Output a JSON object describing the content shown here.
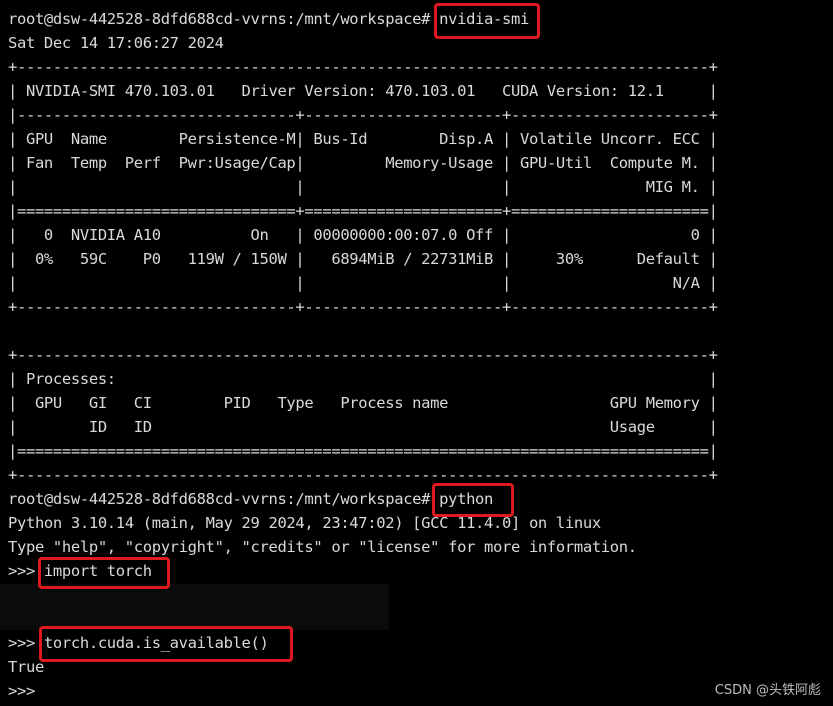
{
  "terminal": {
    "lines": [
      "root@dsw-442528-8dfd688cd-vvrns:/mnt/workspace# nvidia-smi",
      "Sat Dec 14 17:06:27 2024",
      "+-----------------------------------------------------------------------------+",
      "| NVIDIA-SMI 470.103.01   Driver Version: 470.103.01   CUDA Version: 12.1     |",
      "|-------------------------------+----------------------+----------------------+",
      "| GPU  Name        Persistence-M| Bus-Id        Disp.A | Volatile Uncorr. ECC |",
      "| Fan  Temp  Perf  Pwr:Usage/Cap|         Memory-Usage | GPU-Util  Compute M. |",
      "|                               |                      |               MIG M. |",
      "|===============================+======================+======================|",
      "|   0  NVIDIA A10          On   | 00000000:00:07.0 Off |                    0 |",
      "|  0%   59C    P0   119W / 150W |   6894MiB / 22731MiB |     30%      Default |",
      "|                               |                      |                  N/A |",
      "+-------------------------------+----------------------+----------------------+",
      "",
      "+-----------------------------------------------------------------------------+",
      "| Processes:                                                                  |",
      "|  GPU   GI   CI        PID   Type   Process name                  GPU Memory |",
      "|        ID   ID                                                   Usage      |",
      "|=============================================================================|",
      "+-----------------------------------------------------------------------------+",
      "root@dsw-442528-8dfd688cd-vvrns:/mnt/workspace# python",
      "Python 3.10.14 (main, May 29 2024, 23:47:02) [GCC 11.4.0] on linux",
      "Type \"help\", \"copyright\", \"credits\" or \"license\" for more information.",
      ">>> import torch",
      "",
      "",
      ">>> torch.cuda.is_available()",
      "True",
      ">>>"
    ],
    "watermark": "CSDN @头铁阿彪"
  },
  "highlight_color": "#e0191f"
}
